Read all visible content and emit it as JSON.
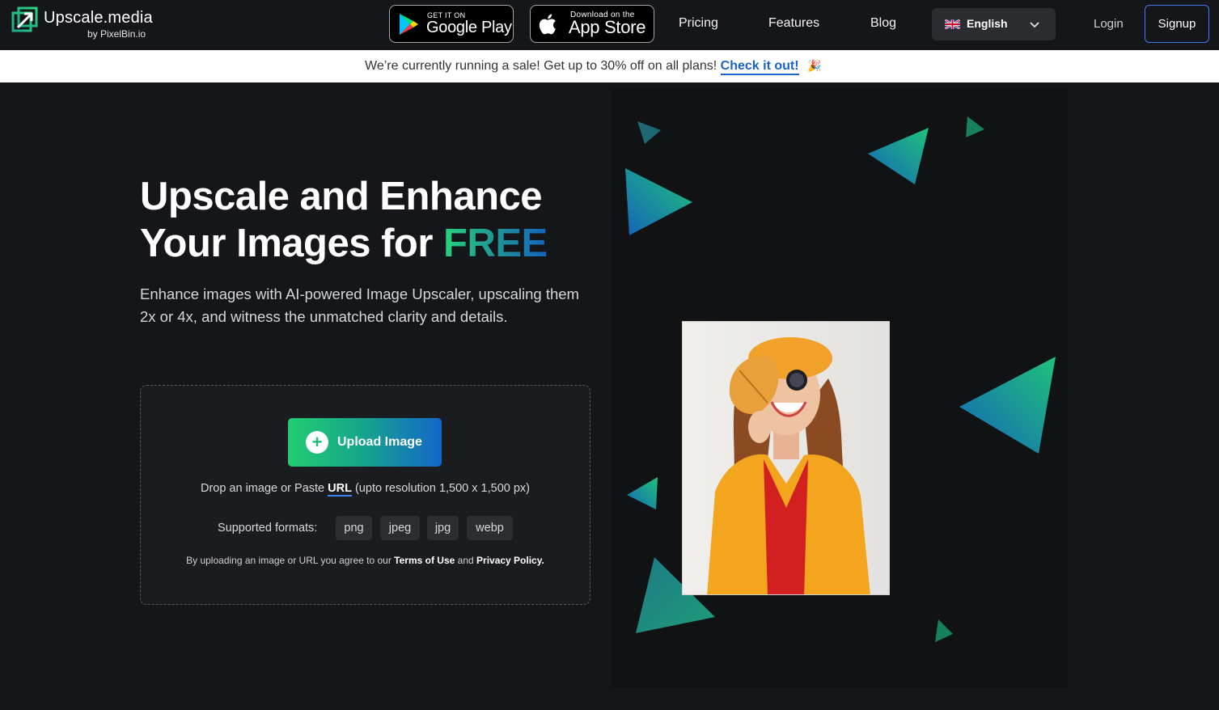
{
  "nav": {
    "logo_title": "Upscale.media",
    "logo_sub": "by PixelBin.io",
    "google_play": {
      "small": "GET IT ON",
      "big": "Google Play"
    },
    "app_store": {
      "small": "Download on the",
      "big": "App Store"
    },
    "links": [
      "Pricing",
      "Features",
      "Blog"
    ],
    "language": "English",
    "login": "Login",
    "signup": "Signup"
  },
  "banner": {
    "text": "We’re currently running a sale! Get up to 30% off on all plans!",
    "link": "Check it out!",
    "emoji": "🎉"
  },
  "hero": {
    "title_line1": "Upscale and Enhance",
    "title_line2": "Your Images for ",
    "title_highlight": "FREE",
    "subtitle": "Enhance images with AI-powered Image Upscaler, upscaling them 2x or 4x, and witness the unmatched clarity and details."
  },
  "upload": {
    "button_label": "Upload Image",
    "drop_prefix": "Drop an image or Paste ",
    "drop_link": "URL",
    "drop_suffix": " (upto resolution 1,500 x 1,500 px)",
    "formats_label": "Supported formats:",
    "formats": [
      "png",
      "jpeg",
      "jpg",
      "webp"
    ],
    "terms_prefix": "By uploading an image or URL you agree to our ",
    "terms_link": "Terms of Use",
    "terms_mid": " and ",
    "privacy_link": "Privacy Policy."
  },
  "colors": {
    "accent_green": "#26d37a",
    "accent_blue": "#1464c4",
    "background": "#151619",
    "link_blue": "#1b62c9"
  },
  "icons": [
    "upscale-logo-icon",
    "google-play-icon",
    "apple-icon",
    "uk-flag-icon",
    "chevron-down-icon",
    "plus-icon"
  ]
}
